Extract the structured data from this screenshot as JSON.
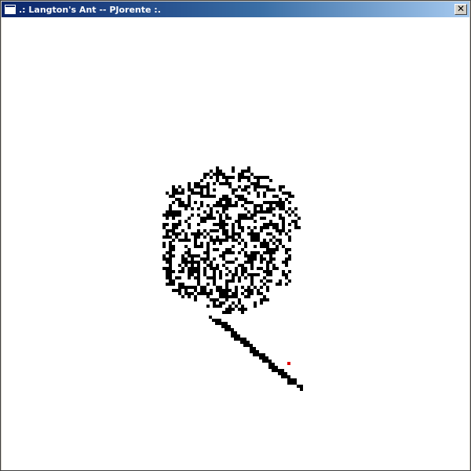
{
  "window": {
    "title": ".: Langton's Ant -- PJorente :.",
    "close_glyph": "✕"
  },
  "colors": {
    "background": "#ffffff",
    "cell": "#000000",
    "ant": "#e00000"
  }
}
